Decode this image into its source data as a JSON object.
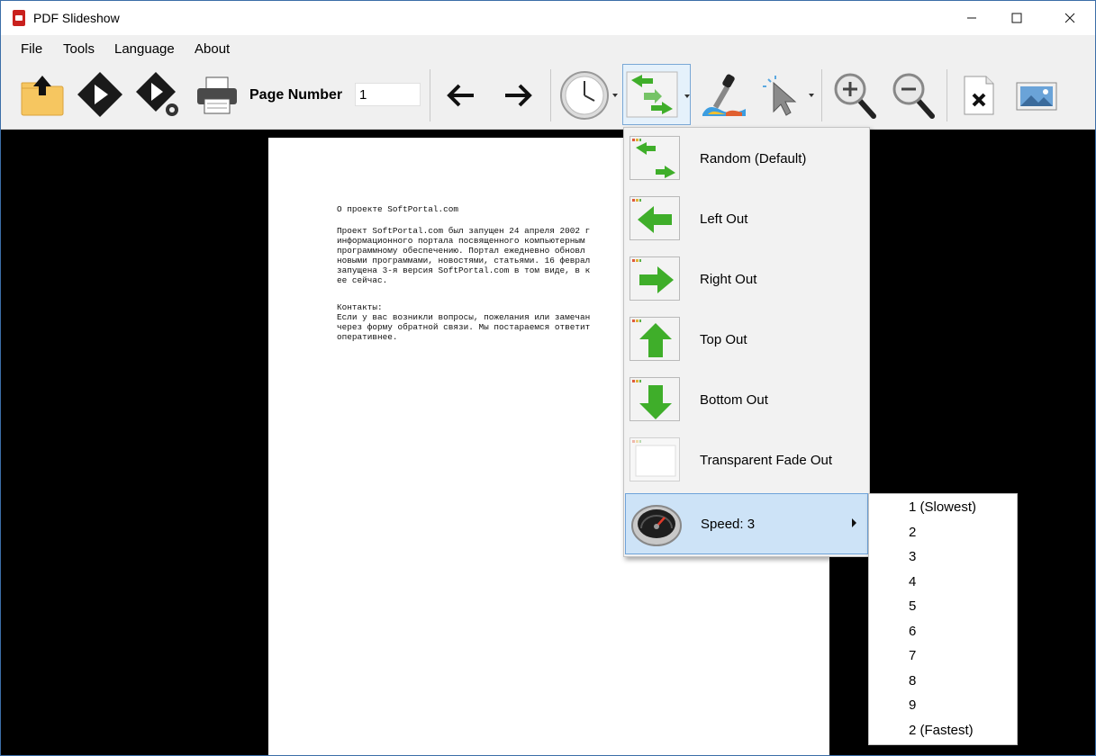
{
  "window": {
    "title": "PDF Slideshow"
  },
  "menu": {
    "file": "File",
    "tools": "Tools",
    "language": "Language",
    "about": "About"
  },
  "toolbar": {
    "page_number_label": "Page Number",
    "page_number_value": "1"
  },
  "document": {
    "lines": [
      "О проекте SoftPortal.com",
      "",
      "Проект SoftPortal.com был запущен 24 апреля 2002 г",
      "информационного портала посвященного компьютерным",
      "программному обеспечению. Портал ежедневно обновл",
      "новыми программами, новостями, статьями. 16 феврал",
      "запущена 3-я версия SoftPortal.com в том виде, в к",
      "ее сейчас.",
      "",
      "Контакты:",
      "Если у вас возникли вопросы, пожелания или замечан",
      "через форму обратной связи. Мы постараемся ответит",
      "оперативнее."
    ]
  },
  "transitions": {
    "items": [
      {
        "label": "Random (Default)",
        "icon": "random-transition-icon"
      },
      {
        "label": "Left Out",
        "icon": "left-arrow-icon"
      },
      {
        "label": "Right Out",
        "icon": "right-arrow-icon"
      },
      {
        "label": "Top Out",
        "icon": "up-arrow-icon"
      },
      {
        "label": "Bottom Out",
        "icon": "down-arrow-icon"
      },
      {
        "label": "Transparent Fade Out",
        "icon": "fade-window-icon"
      }
    ],
    "speed_label": "Speed: 3"
  },
  "speed_options": [
    "1 (Slowest)",
    "2",
    "3",
    "4",
    "5",
    "6",
    "7",
    "8",
    "9",
    "2 (Fastest)"
  ],
  "colors": {
    "accent_green": "#3fae2a",
    "highlight": "#cde3f7",
    "highlight_border": "#6fa3d9"
  }
}
